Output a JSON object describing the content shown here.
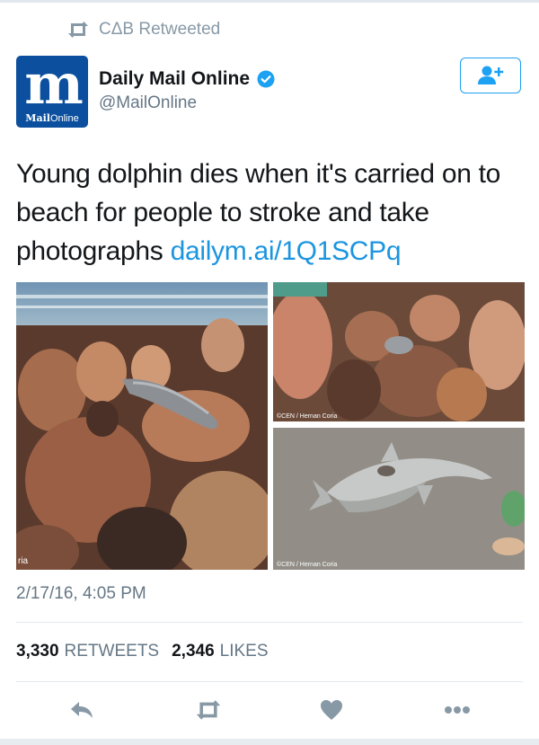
{
  "retweet": {
    "label": "CΔB Retweeted",
    "icon": "retweet-icon"
  },
  "author": {
    "name": "Daily Mail Online",
    "handle": "@MailOnline",
    "verified_icon": "verified-badge-icon",
    "avatar": {
      "monogram": "m",
      "brand_bold": "Mail",
      "brand_rest": "Online",
      "color": "#0b4f9e"
    }
  },
  "follow_button": {
    "icon": "add-user-icon",
    "color": "#1da1f2"
  },
  "tweet": {
    "text": "Young dolphin dies when it's carried on to beach for people to stroke and take photographs",
    "link": "dailym.ai/1Q1SCPq",
    "link_color": "#1b95e0"
  },
  "media": {
    "photos": [
      {
        "caption": "ria"
      },
      {
        "caption": "©CEN / Hernan Coria"
      },
      {
        "caption": "©CEN / Hernan Coria"
      }
    ]
  },
  "timestamp": "2/17/16, 4:05 PM",
  "stats": {
    "retweets_count": "3,330",
    "retweets_label": "RETWEETS",
    "likes_count": "2,346",
    "likes_label": "LIKES"
  },
  "actions": [
    {
      "name": "reply",
      "icon": "reply-icon"
    },
    {
      "name": "retweet",
      "icon": "retweet-icon"
    },
    {
      "name": "like",
      "icon": "heart-icon"
    },
    {
      "name": "more",
      "icon": "more-dots-icon"
    }
  ],
  "colors": {
    "secondary_text": "#657786",
    "icon_gray": "#8899a6",
    "divider": "#e1e8ed"
  }
}
